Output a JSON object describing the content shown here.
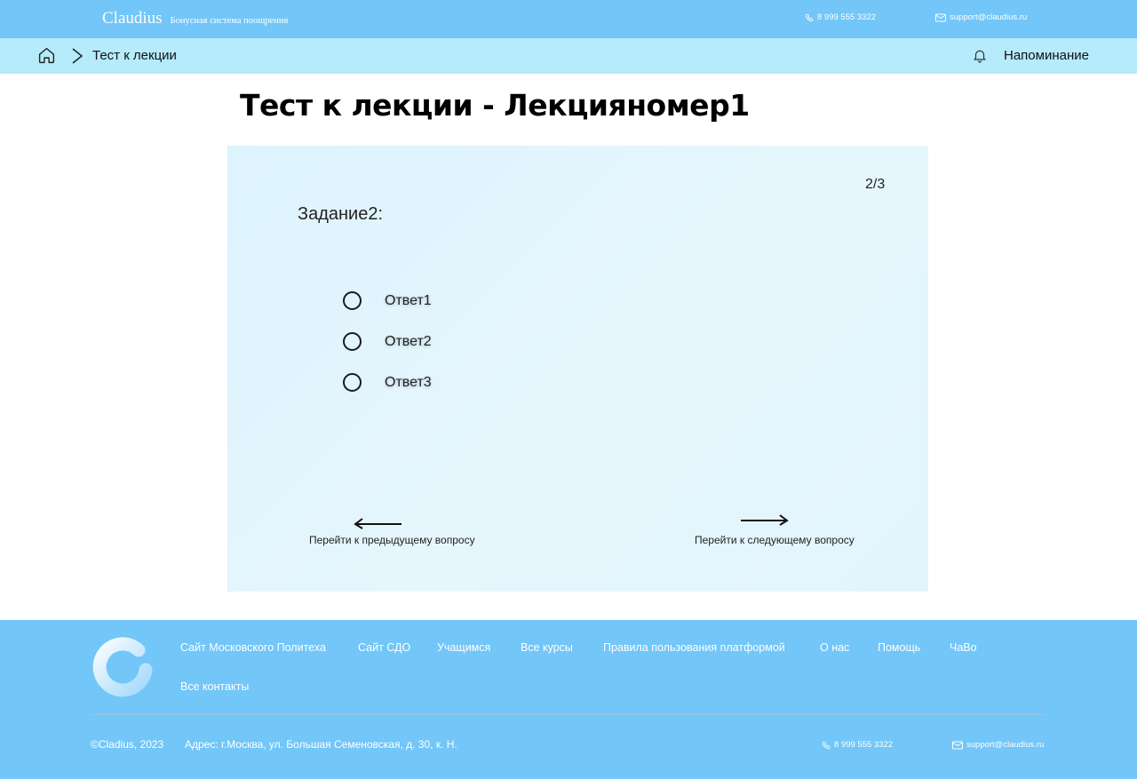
{
  "header": {
    "brand_name": "Claudius",
    "brand_tagline": "Бонусная система поощрения",
    "phone": "8 999 555 3322",
    "email": "support@claudius.ru"
  },
  "breadcrumb": {
    "current": "Тест к лекции",
    "reminder_label": "Напоминание"
  },
  "page_title": "Тест к лекции - Лекцияномер1",
  "question": {
    "counter": "2/3",
    "task_title": "Задание2:",
    "answers": [
      {
        "label": "Ответ1",
        "selected": false
      },
      {
        "label": "Ответ2",
        "selected": false
      },
      {
        "label": "Ответ3",
        "selected": false
      }
    ],
    "prev_label": "Перейти к предыдущему вопросу",
    "next_label": "Перейти к следующему вопросу"
  },
  "footer": {
    "links": [
      "Сайт Московского Политеха",
      "Сайт СДО",
      "Учащимся",
      "Все курсы",
      "Правила пользования платформой",
      "О нас",
      "Помощь",
      "ЧаВо",
      "Все контакты"
    ],
    "copyright": "©Cladius, 2023",
    "address": "Адрес: г.Москва, ул. Большая Семеновская, д. 30, к. Н.",
    "phone": "8 999 555 3322",
    "email": "support@claudius.ru"
  },
  "colors": {
    "topbar": "#72c6f8",
    "breadcrumb_bar": "#b5ebfb",
    "card": "#ddf3fd",
    "footer": "#72c6f8"
  },
  "icons": [
    "home-icon",
    "chevron-right-icon",
    "bell-icon",
    "phone-icon",
    "mail-icon",
    "radio-icon",
    "arrow-left-icon",
    "arrow-right-icon",
    "logo-ring-icon"
  ]
}
